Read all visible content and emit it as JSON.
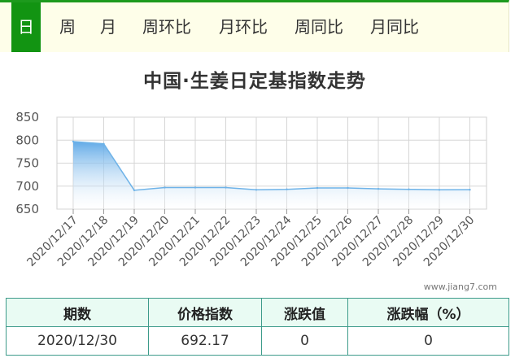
{
  "tabs": [
    {
      "label": "日",
      "active": true
    },
    {
      "label": "周"
    },
    {
      "label": "月"
    },
    {
      "label": "周环比"
    },
    {
      "label": "月环比"
    },
    {
      "label": "周同比"
    },
    {
      "label": "月同比"
    }
  ],
  "watermark": "www.jiang7.com",
  "colors": {
    "accent": "#129412",
    "tab_bg": "#fefee9",
    "series": "#6fb3e8",
    "table_border": "#3d9b8a",
    "table_header_bg": "#e9fbf3"
  },
  "chart_data": {
    "type": "area",
    "title": "中国·生姜日定基指数走势",
    "categories": [
      "2020/12/17",
      "2020/12/18",
      "2020/12/19",
      "2020/12/20",
      "2020/12/21",
      "2020/12/22",
      "2020/12/23",
      "2020/12/24",
      "2020/12/25",
      "2020/12/26",
      "2020/12/27",
      "2020/12/28",
      "2020/12/29",
      "2020/12/30"
    ],
    "values": [
      797,
      792,
      691,
      697,
      697,
      697,
      692,
      693,
      696,
      696,
      694,
      693,
      692,
      692.17
    ],
    "ylim": [
      650,
      850
    ],
    "yticks": [
      650,
      700,
      750,
      800,
      850
    ],
    "grid": true,
    "xlabel": "",
    "ylabel": ""
  },
  "table": {
    "headers": [
      "期数",
      "价格指数",
      "涨跌值",
      "涨跌幅（%）"
    ],
    "rows": [
      [
        "2020/12/30",
        "692.17",
        "0",
        "0"
      ]
    ]
  }
}
